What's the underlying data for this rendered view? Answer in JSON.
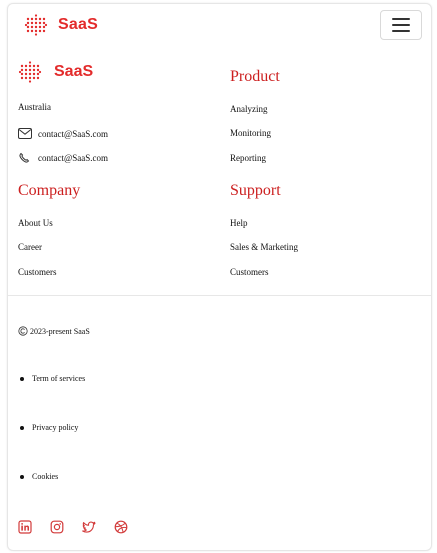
{
  "brand": {
    "name": "SaaS",
    "accent_color": "#e32b2b",
    "logo_icon": "dot-grid-icon"
  },
  "header": {
    "menu_button_icon": "hamburger-menu-icon"
  },
  "footer": {
    "company_info": {
      "address": "Australia",
      "email": "contact@SaaS.com",
      "phone": "contact@SaaS.com",
      "email_icon": "mail-icon",
      "phone_icon": "phone-icon"
    },
    "sections": {
      "product": {
        "title": "Product",
        "links": [
          "Analyzing",
          "Monitoring",
          "Reporting"
        ]
      },
      "company": {
        "title": "Company",
        "links": [
          "About Us",
          "Career",
          "Customers"
        ]
      },
      "support": {
        "title": "Support",
        "links": [
          "Help",
          "Sales & Marketing",
          "Customers"
        ]
      }
    },
    "legal": {
      "copyright": "2023-present SaaS",
      "links": [
        "Term of services",
        "Privacy policy",
        "Cookies"
      ]
    },
    "social": {
      "icons": [
        "linkedin-icon",
        "instagram-icon",
        "twitter-icon",
        "dribbble-icon"
      ],
      "color": "#d23a3a"
    }
  }
}
